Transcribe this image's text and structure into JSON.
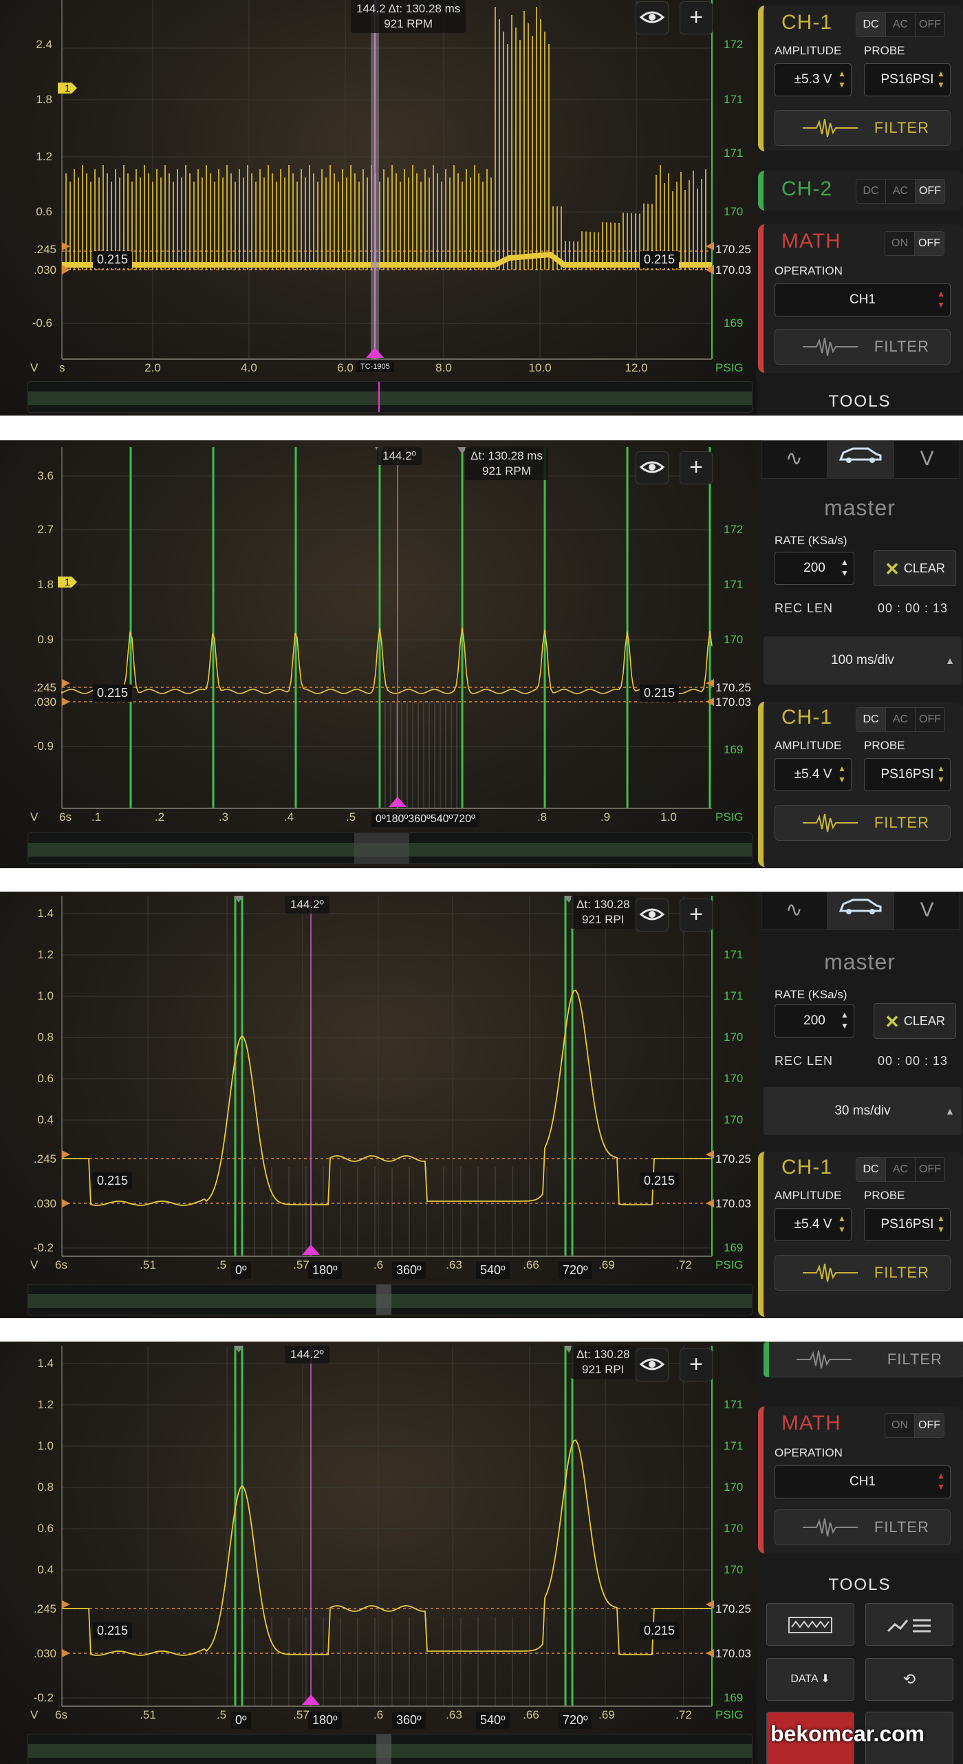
{
  "panels": [
    {
      "id": "p1",
      "left_ticks": [
        "2.4",
        "1.8",
        "1.2",
        "0.6",
        ".245",
        ".030",
        "-0.6"
      ],
      "right_ticks": [
        "172",
        "171",
        "171",
        "170",
        "170.25",
        "170.03",
        "169"
      ],
      "x_ticks": [
        "2.0",
        "4.0",
        "6.0",
        "8.0",
        "10.0",
        "12.0"
      ],
      "x_unit_left": "V",
      "x_unit_s": "s",
      "x_unit_right": "PSIG",
      "marker_label": "1",
      "cursor_readout": {
        "angle": "144.2",
        "delta": "Δt: 130.28 ms",
        "rpm": "921 RPM"
      },
      "value_left": "0.215",
      "value_right": "0.215",
      "cursor_flag": "TC-1905"
    },
    {
      "id": "p2",
      "left_ticks": [
        "3.6",
        "2.7",
        "1.8",
        "0.9",
        ".245",
        ".030",
        "-0.9"
      ],
      "right_ticks": [
        "172",
        "171",
        "170",
        "170.25",
        "170.03",
        "169"
      ],
      "x_ticks": [
        ".1",
        ".2",
        ".3",
        ".4",
        ".5",
        ".8",
        ".9",
        "1.0"
      ],
      "x_unit_left": "V",
      "x_unit_s": "6s",
      "x_unit_right": "PSIG",
      "marker_label": "1",
      "cursor_readout": {
        "angle": "144.2º",
        "delta": "Δt: 130.28 ms",
        "rpm": "921 RPM"
      },
      "value_left": "0.215",
      "value_right": "0.215",
      "degree_labels": "0º180º360º540º720º"
    },
    {
      "id": "p3",
      "left_ticks": [
        "1.4",
        "1.2",
        "1.0",
        "0.8",
        "0.6",
        "0.4",
        ".245",
        ".030",
        "-0.2"
      ],
      "right_ticks": [
        "171",
        "171",
        "170",
        "170",
        "170",
        "170.25",
        "170.03",
        "169"
      ],
      "x_ticks": [
        ".51",
        ".5",
        ".57",
        ".6",
        ".63",
        ".66",
        ".69",
        ".72"
      ],
      "x_unit_left": "V",
      "x_unit_s": "6s",
      "x_unit_right": "PSIG",
      "cursor_readout": {
        "angle": "144.2º",
        "delta": "Δt: 130.28",
        "rpm": "921 RPI"
      },
      "value_left": "0.215",
      "value_right": "0.215",
      "degree_labels": [
        "0º",
        "180º",
        "360º",
        "540º",
        "720º"
      ]
    },
    {
      "id": "p4",
      "left_ticks": [
        "1.4",
        "1.2",
        "1.0",
        "0.8",
        "0.6",
        "0.4",
        ".245",
        ".030",
        "-0.2"
      ],
      "right_ticks": [
        "171",
        "171",
        "170",
        "170",
        "170",
        "170.25",
        "170.03",
        "169"
      ],
      "x_ticks": [
        ".51",
        ".5",
        ".57",
        ".6",
        ".63",
        ".66",
        ".69",
        ".72"
      ],
      "x_unit_left": "V",
      "x_unit_s": "6s",
      "x_unit_right": "PSIG",
      "cursor_readout": {
        "angle": "144.2º",
        "delta": "Δt: 130.28",
        "rpm": "921 RPI"
      },
      "value_left": "0.215",
      "value_right": "0.215",
      "degree_labels": [
        "0º",
        "180º",
        "360º",
        "540º",
        "720º"
      ]
    }
  ],
  "ch1": {
    "name": "CH-1",
    "coupling": [
      "DC",
      "AC",
      "OFF"
    ],
    "selected": "DC",
    "amplitude_label": "AMPLITUDE",
    "probe_label": "PROBE",
    "amplitude_a": "±5.3 V",
    "amplitude_b": "±5.4 V",
    "probe": "PS16PSI",
    "filter": "FILTER"
  },
  "ch2": {
    "name": "CH-2",
    "coupling": [
      "DC",
      "AC",
      "OFF"
    ],
    "selected": "OFF"
  },
  "math": {
    "name": "MATH",
    "states": [
      "ON",
      "OFF"
    ],
    "selected": "OFF",
    "operation_label": "OPERATION",
    "operation": "CH1",
    "filter": "FILTER"
  },
  "tools_label": "TOOLS",
  "master": {
    "label": "master",
    "rate_label": "RATE (KSa/s)",
    "rate": "200",
    "clear": "CLEAR",
    "rec_len_label": "REC LEN",
    "rec_len": "00 : 00 : 13",
    "div_a": "100 ms/div",
    "div_b": "30 ms/div"
  },
  "tabs": [
    "∿",
    "car",
    "V"
  ],
  "tools": {
    "data": "DATA"
  },
  "watermark": "bekomcar.com",
  "colors": {
    "trace": "#e8c93a",
    "grid_green": "#3fbf4a",
    "cursor_magenta": "#e23bd6",
    "ch1": "#c9b63a",
    "ch2": "#3fa64d",
    "math": "#c8403e"
  }
}
